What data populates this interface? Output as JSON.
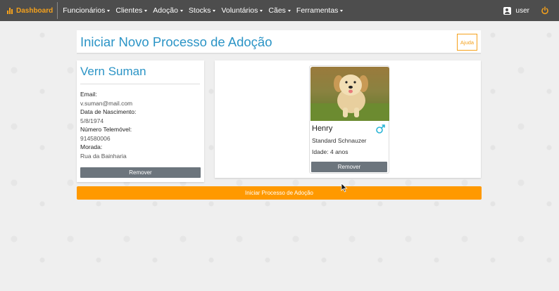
{
  "navbar": {
    "brand": "Dashboard",
    "menu": [
      {
        "label": "Funcionários"
      },
      {
        "label": "Clientes"
      },
      {
        "label": "Adoção"
      },
      {
        "label": "Stocks"
      },
      {
        "label": "Voluntários"
      },
      {
        "label": "Cães"
      },
      {
        "label": "Ferramentas"
      }
    ],
    "user_label": "user",
    "user_icon": "user-icon",
    "power_icon": "power-icon"
  },
  "page": {
    "title": "Iniciar Novo Processo de Adoção",
    "help_label": "Ajuda"
  },
  "client": {
    "name": "Vern Suman",
    "email_label": "Email:",
    "email": "v.suman@mail.com",
    "birth_label": "Data de Nascimento:",
    "birth": "5/8/1974",
    "phone_label": "Número Telemóvel:",
    "phone": "914580006",
    "address_label": "Morada:",
    "address": "Rua da Bainharia",
    "remove_label": "Remover"
  },
  "dog": {
    "name": "Henry",
    "breed": "Standard Schnauzer",
    "age": "Idade: 4 anos",
    "sex_icon": "male-icon",
    "remove_label": "Remover"
  },
  "actions": {
    "start_label": "Iniciar Processo de Adoção"
  },
  "colors": {
    "accent_blue": "#2b94c6",
    "accent_orange": "#ff9900",
    "navbar_bg": "#4d4d4d",
    "button_gray": "#6c757d"
  }
}
